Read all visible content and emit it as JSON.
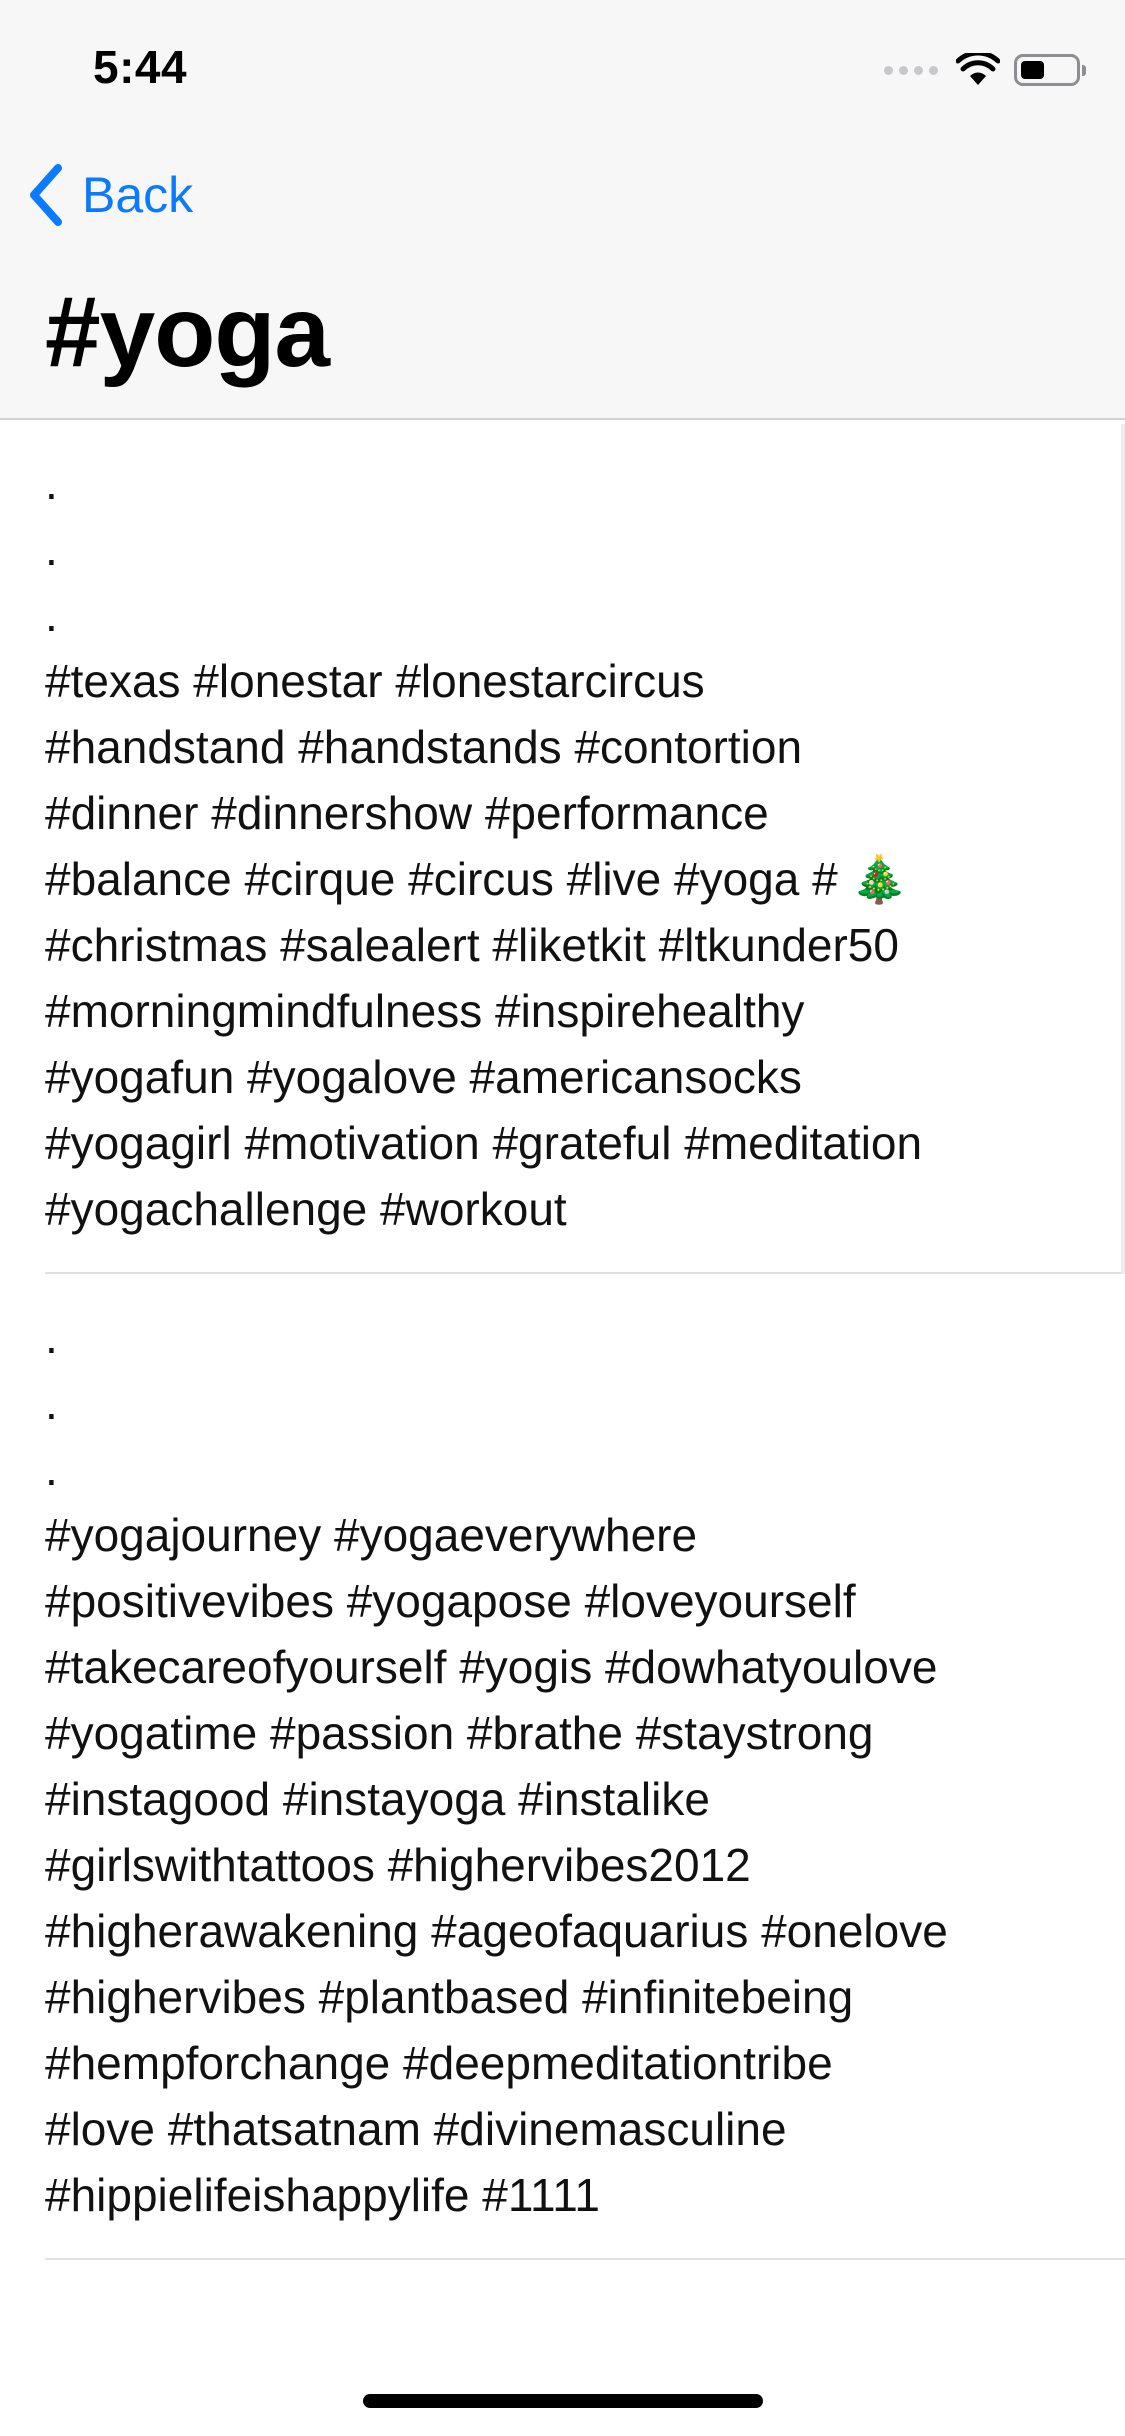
{
  "status_bar": {
    "time": "5:44",
    "battery_level": 0.45,
    "icons": [
      "cellular-signal-icon",
      "wifi-icon",
      "battery-icon"
    ]
  },
  "nav": {
    "back_label": "Back",
    "back_icon": "chevron-left-icon",
    "title": "#yoga",
    "accent_color": "#0a7aff"
  },
  "posts": [
    {
      "text": ".\n.\n.\n#texas #lonestar #lonestarcircus\n#handstand #handstands #contortion\n#dinner #dinnershow #performance\n#balance #cirque #circus #live #yoga # 🎄\n#christmas #salealert #liketkit #ltkunder50\n#morningmindfulness #inspirehealthy\n#yogafun #yogalove #americansocks\n#yogagirl #motivation #grateful #meditation\n#yogachallenge #workout"
    },
    {
      "text": ".\n.\n.\n#yogajourney #yogaeverywhere\n#positivevibes #yogapose #loveyourself\n#takecareofyourself #yogis #dowhatyoulove\n#yogatime #passion #brathe #staystrong\n#instagood #instayoga #instalike\n#girlswithtattoos #highervibes2012\n#higherawakening #ageofaquarius #onelove\n#highervibes #plantbased #infinitebeing\n#hempforchange #deepmeditationtribe\n#love #thatsatnam #divinemasculine\n#hippielifeishappylife #1111"
    }
  ]
}
